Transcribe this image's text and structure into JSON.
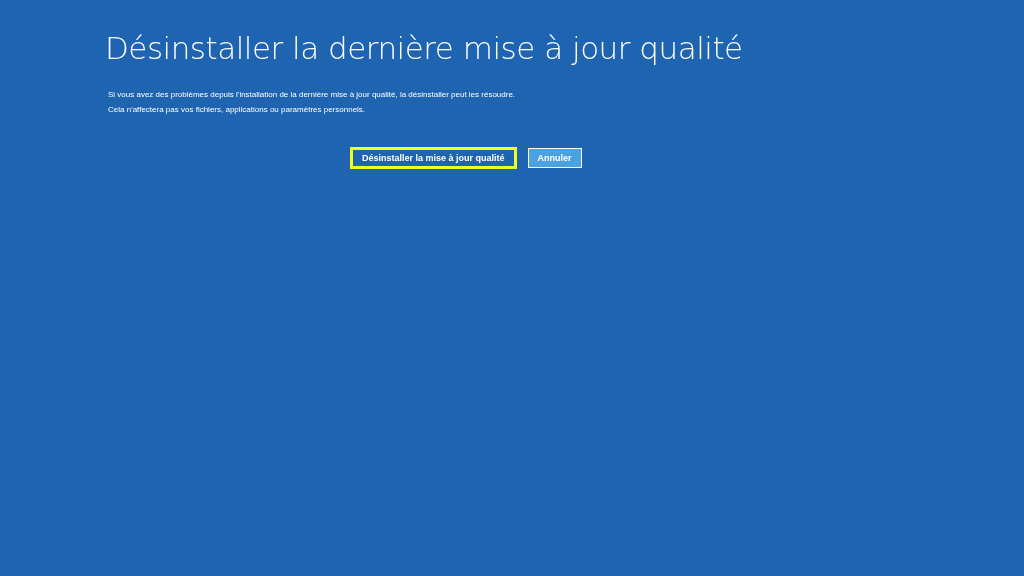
{
  "title": "Désinstaller la dernière mise à jour qualité",
  "description": [
    "Si vous avez des problèmes depuis l'installation de la dernière mise à jour qualité, la désinstaller peut les résoudre.",
    "Cela n'affectera pas vos fichiers, applications ou paramètres personnels."
  ],
  "buttons": [
    {
      "label": "Désinstaller la mise à jour qualité",
      "focused": true
    },
    {
      "label": "Annuler",
      "focused": false
    }
  ]
}
